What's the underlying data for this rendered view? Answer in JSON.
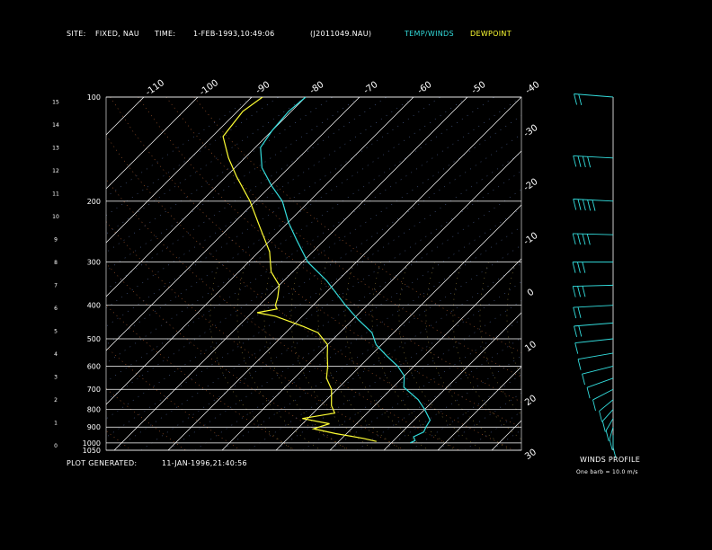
{
  "header": {
    "site_label": "SITE:",
    "site_value": "FIXED, NAU",
    "time_label": "TIME:",
    "time_value": "1-FEB-1993,10:49:06",
    "file_id": "(J2011049.NAU)",
    "temp_winds_legend": "TEMP/WINDS",
    "dewpoint_legend": "DEWPOINT"
  },
  "footer": {
    "plot_generated_label": "PLOT GENERATED:",
    "plot_generated_value": "11-JAN-1996,21:40:56",
    "winds_profile_label": "WINDS PROFILE",
    "barb_note": "One barb = 10.0 m/s"
  },
  "colors": {
    "background": "#000000",
    "temperature": "#33dddd",
    "dewpoint": "#ffff33",
    "winds": "#33dddd",
    "isotherm": "#ffffff",
    "isobar": "#ffffff",
    "mixing_ratio": "#bbbbbb",
    "dry_adiabat": "#ff8844",
    "moist_adiabat": "#ffdd66",
    "saturation_label": "#88aaff"
  },
  "chart_data": {
    "type": "line",
    "title": "",
    "xlabel": "",
    "ylabel": "",
    "pressure_levels": [
      100,
      200,
      300,
      400,
      500,
      600,
      700,
      800,
      900,
      1000,
      1050
    ],
    "pressure_tick_labels": [
      "100",
      "200",
      "300",
      "400",
      "500",
      "600",
      "700",
      "800",
      "900",
      "1000",
      "1050"
    ],
    "pressure_range_hpa": [
      100,
      1050
    ],
    "height_km_ticks": [
      "0",
      "1",
      "2",
      "3",
      "4",
      "5",
      "6",
      "7",
      "8",
      "9",
      "10",
      "11",
      "12",
      "13",
      "14",
      "15"
    ],
    "isotherm_top_labels": [
      "-110",
      "-100",
      "-90",
      "-80",
      "-70",
      "-60",
      "-50",
      "-40"
    ],
    "isotherm_right_labels": [
      "-30",
      "-20",
      "-10",
      "0",
      "10",
      "20",
      "30"
    ],
    "isotherm_range_c": [
      -110,
      30
    ],
    "series": [
      {
        "name": "TEMP/WINDS",
        "points": [
          {
            "p": 100,
            "t": -80
          },
          {
            "p": 110,
            "t": -80.5
          },
          {
            "p": 125,
            "t": -80
          },
          {
            "p": 140,
            "t": -79
          },
          {
            "p": 160,
            "t": -75
          },
          {
            "p": 180,
            "t": -70
          },
          {
            "p": 200,
            "t": -65
          },
          {
            "p": 230,
            "t": -60
          },
          {
            "p": 260,
            "t": -55
          },
          {
            "p": 300,
            "t": -49
          },
          {
            "p": 340,
            "t": -42
          },
          {
            "p": 400,
            "t": -34
          },
          {
            "p": 440,
            "t": -29
          },
          {
            "p": 480,
            "t": -24
          },
          {
            "p": 520,
            "t": -21
          },
          {
            "p": 560,
            "t": -17
          },
          {
            "p": 600,
            "t": -13
          },
          {
            "p": 640,
            "t": -10
          },
          {
            "p": 690,
            "t": -8
          },
          {
            "p": 750,
            "t": -3
          },
          {
            "p": 800,
            "t": 0
          },
          {
            "p": 860,
            "t": 3
          },
          {
            "p": 900,
            "t": 3.5
          },
          {
            "p": 930,
            "t": 4
          },
          {
            "p": 960,
            "t": 3
          },
          {
            "p": 985,
            "t": 4
          },
          {
            "p": 1000,
            "t": 3.5
          }
        ]
      },
      {
        "name": "DEWPOINT",
        "points": [
          {
            "p": 100,
            "t": -88
          },
          {
            "p": 110,
            "t": -89
          },
          {
            "p": 130,
            "t": -88
          },
          {
            "p": 150,
            "t": -83
          },
          {
            "p": 170,
            "t": -78
          },
          {
            "p": 200,
            "t": -71
          },
          {
            "p": 240,
            "t": -64
          },
          {
            "p": 280,
            "t": -58
          },
          {
            "p": 320,
            "t": -54
          },
          {
            "p": 350,
            "t": -50
          },
          {
            "p": 380,
            "t": -48
          },
          {
            "p": 400,
            "t": -47
          },
          {
            "p": 410,
            "t": -46
          },
          {
            "p": 420,
            "t": -49
          },
          {
            "p": 430,
            "t": -45
          },
          {
            "p": 460,
            "t": -38
          },
          {
            "p": 480,
            "t": -34
          },
          {
            "p": 520,
            "t": -30
          },
          {
            "p": 560,
            "t": -28
          },
          {
            "p": 600,
            "t": -26
          },
          {
            "p": 650,
            "t": -24
          },
          {
            "p": 700,
            "t": -21
          },
          {
            "p": 780,
            "t": -18
          },
          {
            "p": 820,
            "t": -16
          },
          {
            "p": 850,
            "t": -21
          },
          {
            "p": 880,
            "t": -15
          },
          {
            "p": 910,
            "t": -17
          },
          {
            "p": 940,
            "t": -12
          },
          {
            "p": 970,
            "t": -6
          },
          {
            "p": 990,
            "t": -3
          }
        ]
      }
    ],
    "winds": [
      {
        "p": 100,
        "speed": 20,
        "dir": 285
      },
      {
        "p": 150,
        "speed": 35,
        "dir": 280
      },
      {
        "p": 200,
        "speed": 50,
        "dir": 280
      },
      {
        "p": 250,
        "speed": 40,
        "dir": 275
      },
      {
        "p": 300,
        "speed": 30,
        "dir": 270
      },
      {
        "p": 350,
        "speed": 25,
        "dir": 265
      },
      {
        "p": 400,
        "speed": 20,
        "dir": 260
      },
      {
        "p": 450,
        "speed": 15,
        "dir": 255
      },
      {
        "p": 500,
        "speed": 10,
        "dir": 250
      },
      {
        "p": 550,
        "speed": 12,
        "dir": 240
      },
      {
        "p": 600,
        "speed": 8,
        "dir": 230
      },
      {
        "p": 650,
        "speed": 10,
        "dir": 220
      },
      {
        "p": 700,
        "speed": 8,
        "dir": 210
      },
      {
        "p": 750,
        "speed": 10,
        "dir": 200
      },
      {
        "p": 800,
        "speed": 12,
        "dir": 195
      },
      {
        "p": 850,
        "speed": 12,
        "dir": 190
      },
      {
        "p": 900,
        "speed": 10,
        "dir": 185
      },
      {
        "p": 950,
        "speed": 8,
        "dir": 180
      }
    ],
    "grid": true,
    "legend_position": "top-right"
  }
}
